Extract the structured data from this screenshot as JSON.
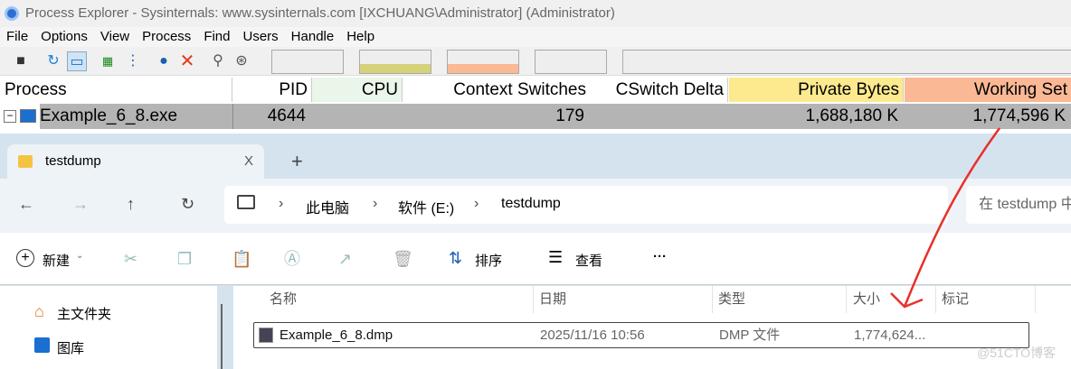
{
  "procexp": {
    "title": "Process Explorer - Sysinternals: www.sysinternals.com [IXCHUANG\\Administrator] (Administrator)",
    "menu": [
      "File",
      "Options",
      "View",
      "Process",
      "Find",
      "Users",
      "Handle",
      "Help"
    ],
    "columns": {
      "process": "Process",
      "pid": "PID",
      "cpu": "CPU",
      "ctx": "Context Switches",
      "delta": "CSwitch Delta",
      "private": "Private Bytes",
      "working": "Working Set"
    },
    "row": {
      "name": "Example_6_8.exe",
      "pid": "4644",
      "cpu": "",
      "ctx": "179",
      "delta": "",
      "private": "1,688,180 K",
      "working": "1,774,596 K"
    },
    "colors": {
      "cpu": "#eaf6ea",
      "private": "#fde98e",
      "working": "#fbb894"
    }
  },
  "explorer": {
    "tab": "testdump",
    "new_tab": "+",
    "close": "X",
    "breadcrumb": [
      "此电脑",
      "软件 (E:)",
      "testdump"
    ],
    "search_placeholder": "在 testdump 中搜索",
    "cmd": {
      "new": "新建",
      "sort": "排序",
      "view": "查看",
      "more": "···"
    },
    "sidebar": [
      "主文件夹",
      "图库"
    ],
    "columns": [
      "名称",
      "日期",
      "类型",
      "大小",
      "标记"
    ],
    "file": {
      "name": "Example_6_8.dmp",
      "date": "2025/11/16 10:56",
      "type": "DMP 文件",
      "size": "1,774,624..."
    }
  },
  "watermark": "@51CTO博客"
}
